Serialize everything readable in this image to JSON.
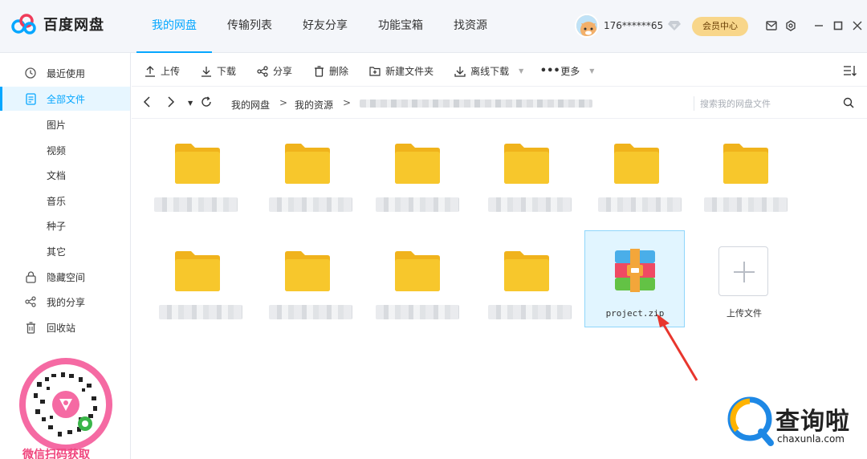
{
  "app": {
    "name": "百度网盘"
  },
  "nav": {
    "tabs": [
      "我的网盘",
      "传输列表",
      "好友分享",
      "功能宝箱",
      "找资源"
    ],
    "active_index": 0
  },
  "user": {
    "phone": "176******65",
    "vip_label": "会员中心"
  },
  "sidebar": {
    "items": [
      {
        "label": "最近使用",
        "icon": "clock-icon"
      },
      {
        "label": "全部文件",
        "icon": "document-icon",
        "active": true
      },
      {
        "label": "图片"
      },
      {
        "label": "视频"
      },
      {
        "label": "文档"
      },
      {
        "label": "音乐"
      },
      {
        "label": "种子"
      },
      {
        "label": "其它"
      },
      {
        "label": "隐藏空间",
        "icon": "lock-icon"
      },
      {
        "label": "我的分享",
        "icon": "share-icon"
      },
      {
        "label": "回收站",
        "icon": "trash-icon"
      }
    ],
    "qr_caption": "微信扫码获取"
  },
  "toolbar": {
    "upload": "上传",
    "download": "下载",
    "share": "分享",
    "delete": "删除",
    "new_folder": "新建文件夹",
    "offline_download": "离线下载",
    "more": "更多"
  },
  "pathbar": {
    "crumbs": [
      "我的网盘",
      "我的资源"
    ],
    "search_placeholder": "搜索我的网盘文件"
  },
  "files": {
    "zip_name": "project.zip",
    "upload_label": "上传文件"
  },
  "colors": {
    "accent": "#06a7ff",
    "folder": "#f7c72c",
    "vip": "#f8d68a",
    "arrow": "#e8362d"
  },
  "watermark": {
    "text": "查询啦",
    "url": "chaxunla.com"
  }
}
